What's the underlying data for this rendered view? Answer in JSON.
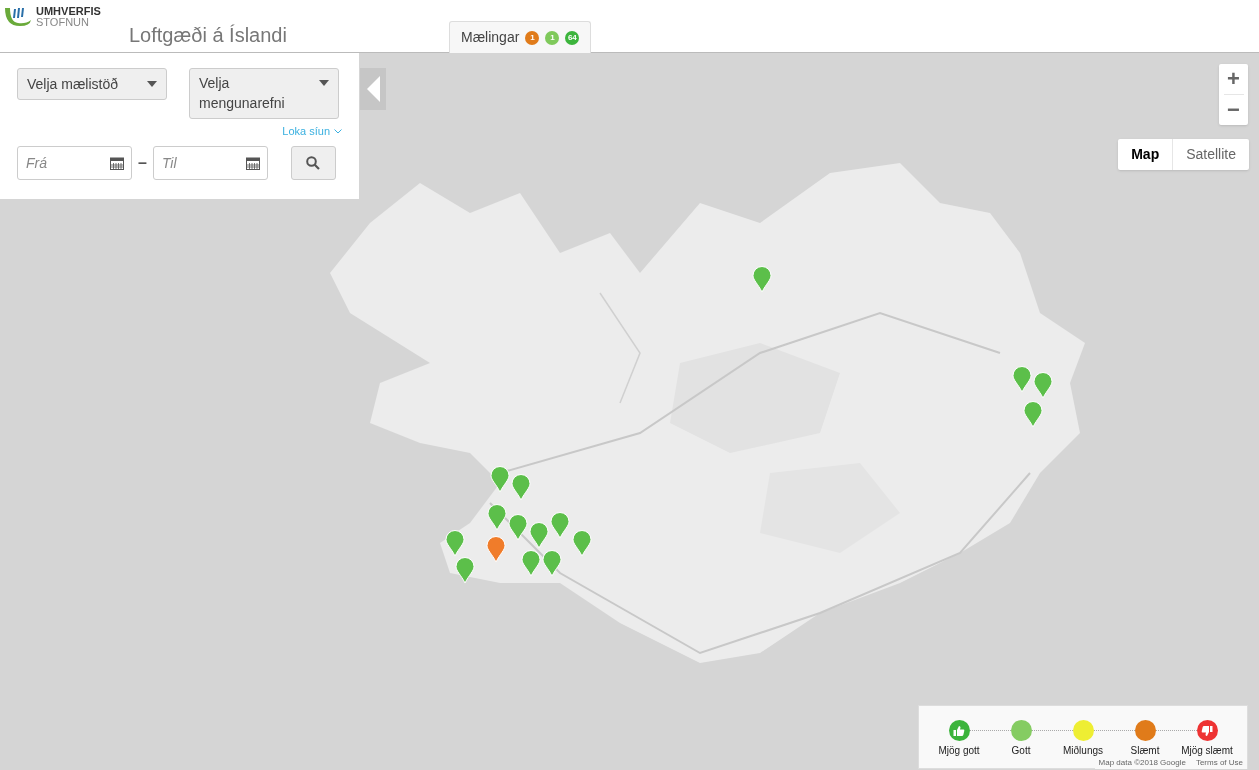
{
  "header": {
    "logo_line_1": "UMHVERFIS",
    "logo_line_2": "STOFNUN",
    "title": "Loftgæði á Íslandi"
  },
  "tabs": [
    {
      "label": "Mælingar",
      "selected": true,
      "counts": [
        {
          "text": "1",
          "color": "#e07b1a"
        },
        {
          "text": "1",
          "color": "#7fc95b"
        },
        {
          "text": "64",
          "color": "#3cb43c"
        }
      ]
    }
  ],
  "filters": {
    "station_select": "Velja mælistöð",
    "pollutant_select": "Velja mengunarefni",
    "close_filter_link": "Loka síun",
    "from_field": {
      "placeholder": "Frá"
    },
    "dash": "–",
    "to_field": {
      "placeholder": "Til"
    }
  },
  "map_controls": {
    "zoom_in": "+",
    "zoom_out": "−",
    "map_types": [
      {
        "label": "Map",
        "selected": true
      },
      {
        "label": "Satellite",
        "selected": false
      }
    ]
  },
  "markers": [
    {
      "color": "#5cbf4a"
    },
    {
      "color": "#5cbf4a"
    },
    {
      "color": "#5cbf4a"
    },
    {
      "color": "#5cbf4a"
    },
    {
      "color": "#5cbf4a"
    },
    {
      "color": "#5cbf4a"
    },
    {
      "color": "#5cbf4a"
    },
    {
      "color": "#5cbf4a"
    },
    {
      "color": "#5cbf4a"
    },
    {
      "color": "#5cbf4a"
    },
    {
      "color": "#5cbf4a"
    },
    {
      "color": "#5cbf4a"
    },
    {
      "color": "#5cbf4a"
    },
    {
      "color": "#5cbf4a"
    },
    {
      "color": "#5cbf4a"
    },
    {
      "color": "#f07c2a"
    }
  ],
  "legend": [
    {
      "label": "Mjög gott",
      "color": "#3cb43c",
      "kind": "up"
    },
    {
      "label": "Gott",
      "color": "#85cc62",
      "kind": "plain"
    },
    {
      "label": "Miðlungs",
      "color": "#eeee33",
      "kind": "plain"
    },
    {
      "label": "Slæmt",
      "color": "#e07b1a",
      "kind": "plain"
    },
    {
      "label": "Mjög slæmt",
      "color": "#ee3333",
      "kind": "down"
    }
  ],
  "attribution": {
    "map_data": "Map data ©2018 Google",
    "terms": "Terms of Use"
  }
}
